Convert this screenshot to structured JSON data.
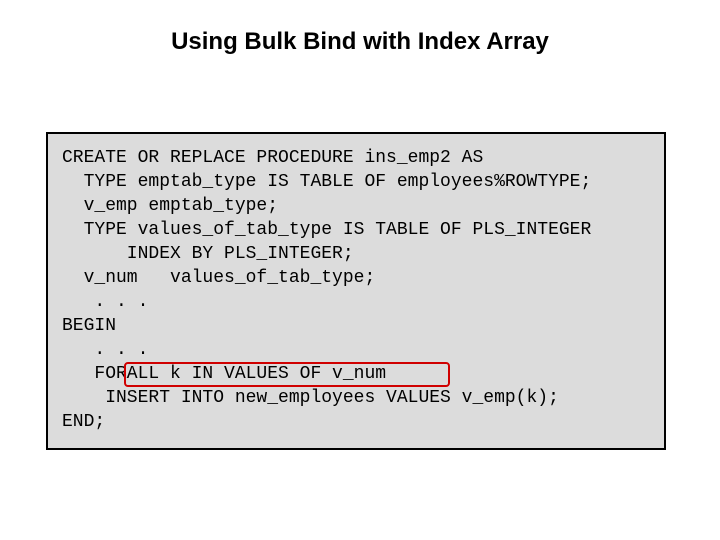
{
  "title": "Using Bulk Bind with Index Array",
  "code": {
    "l0": "CREATE OR REPLACE PROCEDURE ins_emp2 AS",
    "l1": "  TYPE emptab_type IS TABLE OF employees%ROWTYPE;",
    "l2": "  v_emp emptab_type;",
    "l3": "  TYPE values_of_tab_type IS TABLE OF PLS_INTEGER",
    "l4": "      INDEX BY PLS_INTEGER;",
    "l5": "  v_num   values_of_tab_type;",
    "l6": "   . . .",
    "l7": "BEGIN",
    "l8": "   . . .",
    "l9": "   FORALL k IN VALUES OF v_num",
    "l10": "    INSERT INTO new_employees VALUES v_emp(k);",
    "l11": "END;"
  }
}
